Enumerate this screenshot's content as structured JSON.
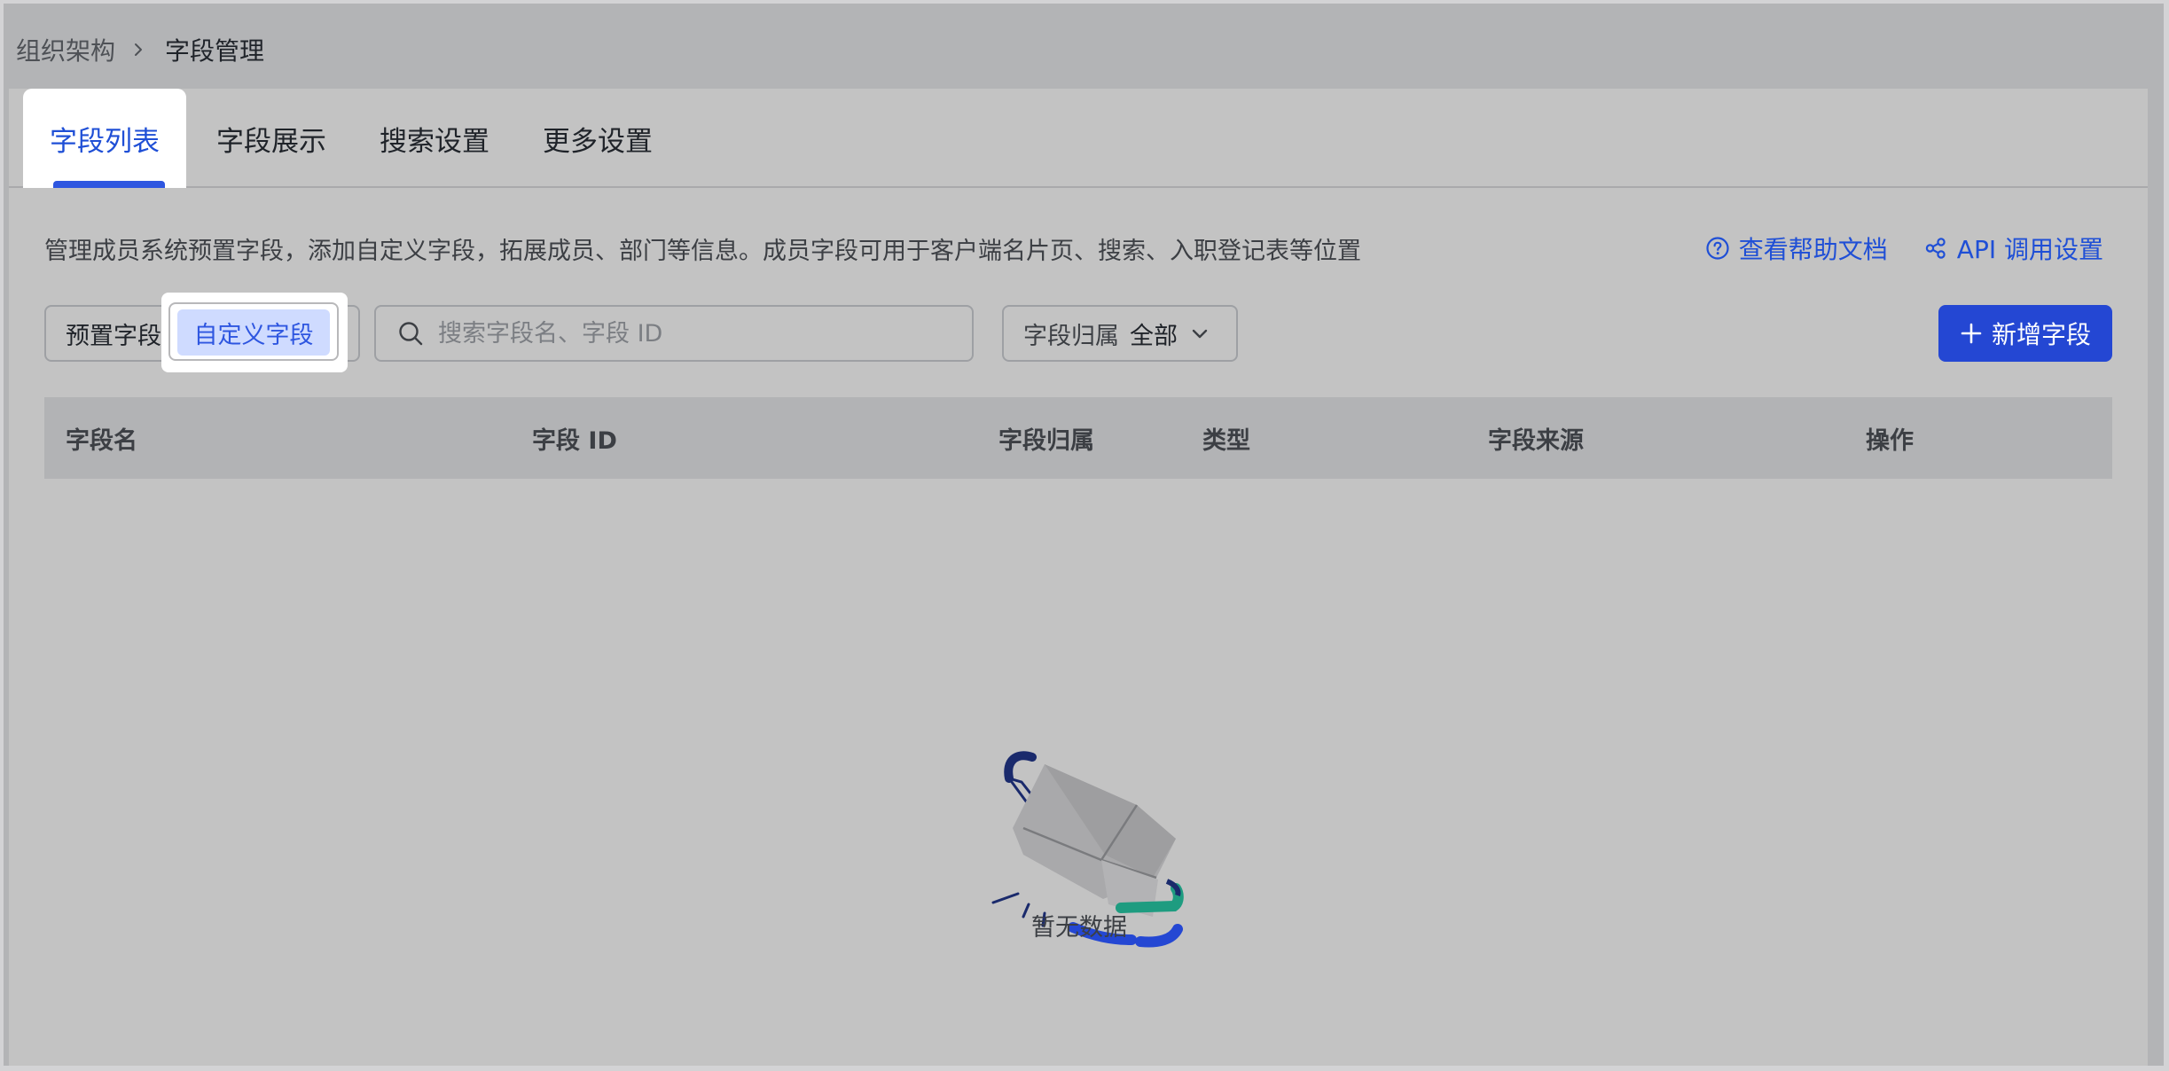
{
  "breadcrumb": {
    "parent": "组织架构",
    "current": "字段管理"
  },
  "tabs": [
    {
      "label": "字段列表",
      "active": true
    },
    {
      "label": "字段展示",
      "active": false
    },
    {
      "label": "搜索设置",
      "active": false
    },
    {
      "label": "更多设置",
      "active": false
    }
  ],
  "description": "管理成员系统预置字段，添加自定义字段，拓展成员、部门等信息。成员字段可用于客户端名片页、搜索、入职登记表等位置",
  "links": {
    "help": "查看帮助文档",
    "api": "API 调用设置"
  },
  "segment": {
    "preset": "预置字段",
    "custom": "自定义字段",
    "selected": "自定义字段"
  },
  "search": {
    "placeholder": "搜索字段名、字段 ID",
    "value": ""
  },
  "filter": {
    "label": "字段归属",
    "value": "全部"
  },
  "add_button": "新增字段",
  "table": {
    "columns": [
      "字段名",
      "字段 ID",
      "字段归属",
      "类型",
      "字段来源",
      "操作"
    ],
    "rows": []
  },
  "empty_text": "暂无数据",
  "colors": {
    "accent": "#2e56e0",
    "primary_button": "#2447d3",
    "selected_bg": "#cfdbff",
    "illustration_green": "#1e9c80",
    "illustration_navy": "#1a2a6c"
  }
}
